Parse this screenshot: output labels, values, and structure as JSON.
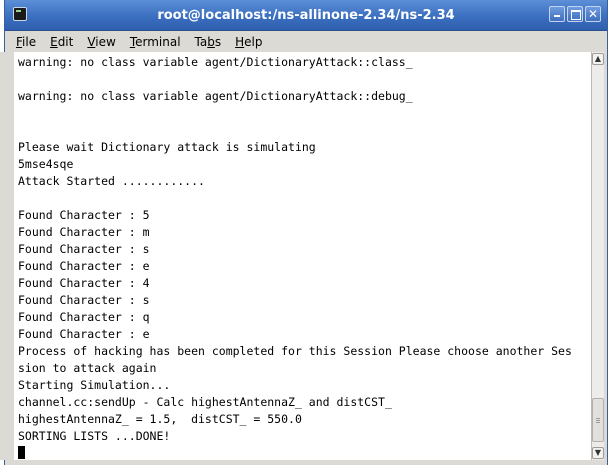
{
  "window": {
    "title": "root@localhost:/ns-allinone-2.34/ns-2.34",
    "icon": "terminal-icon",
    "controls": [
      "minimize-icon",
      "maximize-icon",
      "close-icon"
    ],
    "close_glyph": "✕"
  },
  "menubar": {
    "items": [
      {
        "label": "File",
        "mnemonic": "F",
        "rest": "ile"
      },
      {
        "label": "Edit",
        "mnemonic": "E",
        "rest": "dit"
      },
      {
        "label": "View",
        "mnemonic": "V",
        "rest": "iew"
      },
      {
        "label": "Terminal",
        "mnemonic": "T",
        "rest": "erminal"
      },
      {
        "label": "Tabs",
        "pre": "Ta",
        "mnemonic": "b",
        "rest": "s"
      },
      {
        "label": "Help",
        "mnemonic": "H",
        "rest": "elp"
      }
    ]
  },
  "terminal": {
    "lines": [
      "warning: no class variable agent/DictionaryAttack::class_",
      "",
      "warning: no class variable agent/DictionaryAttack::debug_",
      "",
      "",
      "Please wait Dictionary attack is simulating",
      "5mse4sqe",
      "Attack Started ............",
      "",
      "Found Character : 5",
      "Found Character : m",
      "Found Character : s",
      "Found Character : e",
      "Found Character : 4",
      "Found Character : s",
      "Found Character : q",
      "Found Character : e",
      "Process of hacking has been completed for this Session Please choose another Ses",
      "sion to attack again",
      "Starting Simulation...",
      "channel.cc:sendUp - Calc highestAntennaZ_ and distCST_",
      "highestAntennaZ_ = 1.5,  distCST_ = 550.0",
      "SORTING LISTS ...DONE!"
    ]
  },
  "colors": {
    "titlebar": "#3b6fc0",
    "background": "#ffffff",
    "text": "#000000"
  }
}
